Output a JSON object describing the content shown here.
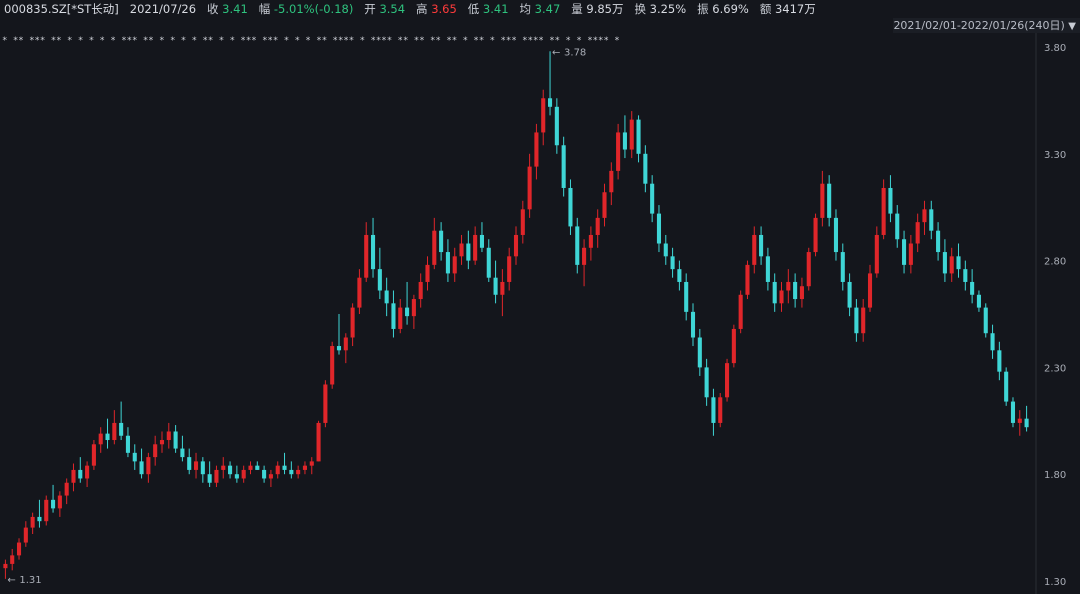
{
  "header": {
    "code": "000835.SZ[*ST长动]",
    "date": "2021/07/26",
    "close_label": "收",
    "close": "3.41",
    "change_label": "幅",
    "change": "-5.01%(-0.18)",
    "open_label": "开",
    "open": "3.54",
    "high_label": "高",
    "high": "3.65",
    "low_label": "低",
    "low": "3.41",
    "avg_label": "均",
    "avg": "3.47",
    "volume_label": "量",
    "volume": "9.85万",
    "turnover_label": "换",
    "turnover": "3.25%",
    "amplitude_label": "振",
    "amplitude": "6.69%",
    "amount_label": "额",
    "amount": "3417万"
  },
  "range": {
    "text": "2021/02/01-2022/01/26(240日)",
    "dropdown_icon": "triangle-down-icon"
  },
  "colors": {
    "up": "#e0262a",
    "down": "#3fd6d6",
    "flat": "#e8e8e8",
    "background": "#14161c",
    "grid": "#2a2d35",
    "max_label": "#ff3b3b",
    "min_label": "#2ec27e"
  },
  "chart_data": {
    "type": "candlestick",
    "title": "",
    "y_ticks": [
      "3.80",
      "3.30",
      "2.80",
      "2.30",
      "1.80",
      "1.30"
    ],
    "ylim": [
      1.3,
      3.8
    ],
    "max_marker": "3.78",
    "min_marker": "1.31",
    "star_row": "* ** *** ** *  *   *  *  *  *** ** *  * *  *  ** *  *   ***  ***  * * * ** ****  *  **** ** **  ** **  *  ** * *** **** **  *  * ****  *",
    "candles": [
      [
        1.36,
        1.4,
        1.31,
        1.38
      ],
      [
        1.38,
        1.45,
        1.35,
        1.42
      ],
      [
        1.42,
        1.5,
        1.4,
        1.48
      ],
      [
        1.48,
        1.58,
        1.46,
        1.55
      ],
      [
        1.55,
        1.62,
        1.52,
        1.6
      ],
      [
        1.6,
        1.68,
        1.55,
        1.58
      ],
      [
        1.58,
        1.7,
        1.56,
        1.68
      ],
      [
        1.68,
        1.75,
        1.62,
        1.64
      ],
      [
        1.64,
        1.72,
        1.6,
        1.7
      ],
      [
        1.7,
        1.78,
        1.66,
        1.76
      ],
      [
        1.76,
        1.85,
        1.72,
        1.82
      ],
      [
        1.82,
        1.88,
        1.76,
        1.78
      ],
      [
        1.78,
        1.86,
        1.74,
        1.84
      ],
      [
        1.84,
        1.96,
        1.82,
        1.94
      ],
      [
        1.94,
        2.02,
        1.9,
        1.99
      ],
      [
        1.99,
        2.06,
        1.92,
        1.96
      ],
      [
        1.96,
        2.1,
        1.94,
        2.04
      ],
      [
        2.04,
        2.14,
        1.96,
        1.98
      ],
      [
        1.98,
        2.02,
        1.88,
        1.9
      ],
      [
        1.9,
        1.94,
        1.82,
        1.86
      ],
      [
        1.86,
        1.92,
        1.78,
        1.8
      ],
      [
        1.8,
        1.9,
        1.76,
        1.88
      ],
      [
        1.88,
        1.98,
        1.84,
        1.94
      ],
      [
        1.94,
        2.0,
        1.9,
        1.96
      ],
      [
        1.96,
        2.04,
        1.92,
        2.0
      ],
      [
        2.0,
        2.03,
        1.9,
        1.92
      ],
      [
        1.92,
        1.98,
        1.86,
        1.88
      ],
      [
        1.88,
        1.92,
        1.8,
        1.82
      ],
      [
        1.82,
        1.9,
        1.78,
        1.86
      ],
      [
        1.86,
        1.88,
        1.76,
        1.8
      ],
      [
        1.8,
        1.86,
        1.74,
        1.76
      ],
      [
        1.76,
        1.84,
        1.74,
        1.82
      ],
      [
        1.82,
        1.88,
        1.78,
        1.84
      ],
      [
        1.84,
        1.86,
        1.78,
        1.8
      ],
      [
        1.8,
        1.84,
        1.76,
        1.78
      ],
      [
        1.78,
        1.84,
        1.76,
        1.82
      ],
      [
        1.82,
        1.86,
        1.8,
        1.84
      ],
      [
        1.84,
        1.86,
        1.82,
        1.82
      ],
      [
        1.82,
        1.84,
        1.76,
        1.78
      ],
      [
        1.78,
        1.82,
        1.74,
        1.8
      ],
      [
        1.8,
        1.86,
        1.78,
        1.84
      ],
      [
        1.84,
        1.9,
        1.8,
        1.82
      ],
      [
        1.82,
        1.86,
        1.78,
        1.8
      ],
      [
        1.8,
        1.84,
        1.78,
        1.82
      ],
      [
        1.82,
        1.86,
        1.8,
        1.84
      ],
      [
        1.84,
        1.88,
        1.8,
        1.86
      ],
      [
        1.86,
        2.05,
        1.86,
        2.04
      ],
      [
        2.04,
        2.24,
        2.02,
        2.22
      ],
      [
        2.22,
        2.42,
        2.2,
        2.4
      ],
      [
        2.4,
        2.55,
        2.36,
        2.38
      ],
      [
        2.38,
        2.46,
        2.32,
        2.44
      ],
      [
        2.44,
        2.6,
        2.4,
        2.58
      ],
      [
        2.58,
        2.76,
        2.55,
        2.72
      ],
      [
        2.72,
        2.98,
        2.7,
        2.92
      ],
      [
        2.92,
        3.0,
        2.72,
        2.76
      ],
      [
        2.76,
        2.86,
        2.62,
        2.66
      ],
      [
        2.66,
        2.72,
        2.54,
        2.6
      ],
      [
        2.6,
        2.66,
        2.44,
        2.48
      ],
      [
        2.48,
        2.62,
        2.46,
        2.58
      ],
      [
        2.58,
        2.7,
        2.5,
        2.54
      ],
      [
        2.54,
        2.64,
        2.48,
        2.62
      ],
      [
        2.62,
        2.74,
        2.58,
        2.7
      ],
      [
        2.7,
        2.82,
        2.66,
        2.78
      ],
      [
        2.78,
        3.0,
        2.76,
        2.94
      ],
      [
        2.94,
        2.98,
        2.8,
        2.84
      ],
      [
        2.84,
        2.9,
        2.7,
        2.74
      ],
      [
        2.74,
        2.86,
        2.7,
        2.82
      ],
      [
        2.82,
        2.92,
        2.78,
        2.88
      ],
      [
        2.88,
        2.94,
        2.76,
        2.8
      ],
      [
        2.8,
        2.96,
        2.78,
        2.92
      ],
      [
        2.92,
        2.98,
        2.84,
        2.86
      ],
      [
        2.86,
        2.9,
        2.7,
        2.72
      ],
      [
        2.72,
        2.8,
        2.6,
        2.64
      ],
      [
        2.64,
        2.76,
        2.54,
        2.7
      ],
      [
        2.7,
        2.86,
        2.66,
        2.82
      ],
      [
        2.82,
        2.96,
        2.78,
        2.92
      ],
      [
        2.92,
        3.08,
        2.88,
        3.04
      ],
      [
        3.04,
        3.3,
        3.0,
        3.24
      ],
      [
        3.24,
        3.44,
        3.18,
        3.4
      ],
      [
        3.4,
        3.6,
        3.34,
        3.56
      ],
      [
        3.56,
        3.78,
        3.48,
        3.52
      ],
      [
        3.52,
        3.56,
        3.3,
        3.34
      ],
      [
        3.34,
        3.38,
        3.1,
        3.14
      ],
      [
        3.14,
        3.18,
        2.92,
        2.96
      ],
      [
        2.96,
        3.0,
        2.74,
        2.78
      ],
      [
        2.78,
        2.9,
        2.68,
        2.86
      ],
      [
        2.86,
        2.96,
        2.8,
        2.92
      ],
      [
        2.92,
        3.04,
        2.86,
        3.0
      ],
      [
        3.0,
        3.16,
        2.96,
        3.12
      ],
      [
        3.12,
        3.26,
        3.06,
        3.22
      ],
      [
        3.22,
        3.44,
        3.18,
        3.4
      ],
      [
        3.4,
        3.48,
        3.28,
        3.32
      ],
      [
        3.32,
        3.5,
        3.28,
        3.46
      ],
      [
        3.46,
        3.48,
        3.26,
        3.3
      ],
      [
        3.3,
        3.34,
        3.12,
        3.16
      ],
      [
        3.16,
        3.2,
        2.98,
        3.02
      ],
      [
        3.02,
        3.06,
        2.84,
        2.88
      ],
      [
        2.88,
        2.92,
        2.78,
        2.82
      ],
      [
        2.82,
        2.86,
        2.72,
        2.76
      ],
      [
        2.76,
        2.8,
        2.66,
        2.7
      ],
      [
        2.7,
        2.74,
        2.52,
        2.56
      ],
      [
        2.56,
        2.6,
        2.4,
        2.44
      ],
      [
        2.44,
        2.48,
        2.26,
        2.3
      ],
      [
        2.3,
        2.34,
        2.12,
        2.16
      ],
      [
        2.16,
        2.2,
        1.98,
        2.04
      ],
      [
        2.04,
        2.18,
        2.02,
        2.16
      ],
      [
        2.16,
        2.34,
        2.14,
        2.32
      ],
      [
        2.32,
        2.5,
        2.3,
        2.48
      ],
      [
        2.48,
        2.66,
        2.46,
        2.64
      ],
      [
        2.64,
        2.8,
        2.62,
        2.78
      ],
      [
        2.78,
        2.96,
        2.74,
        2.92
      ],
      [
        2.92,
        2.96,
        2.78,
        2.82
      ],
      [
        2.82,
        2.86,
        2.66,
        2.7
      ],
      [
        2.7,
        2.74,
        2.56,
        2.6
      ],
      [
        2.6,
        2.7,
        2.56,
        2.66
      ],
      [
        2.66,
        2.76,
        2.6,
        2.7
      ],
      [
        2.7,
        2.74,
        2.58,
        2.62
      ],
      [
        2.62,
        2.72,
        2.58,
        2.68
      ],
      [
        2.68,
        2.86,
        2.66,
        2.84
      ],
      [
        2.84,
        3.02,
        2.82,
        3.0
      ],
      [
        3.0,
        3.22,
        2.96,
        3.16
      ],
      [
        3.16,
        3.2,
        2.96,
        3.0
      ],
      [
        3.0,
        3.04,
        2.8,
        2.84
      ],
      [
        2.84,
        2.88,
        2.66,
        2.7
      ],
      [
        2.7,
        2.74,
        2.54,
        2.58
      ],
      [
        2.58,
        2.62,
        2.42,
        2.46
      ],
      [
        2.46,
        2.62,
        2.42,
        2.58
      ],
      [
        2.58,
        2.78,
        2.56,
        2.74
      ],
      [
        2.74,
        2.96,
        2.72,
        2.92
      ],
      [
        2.92,
        3.18,
        2.9,
        3.14
      ],
      [
        3.14,
        3.2,
        2.98,
        3.02
      ],
      [
        3.02,
        3.06,
        2.86,
        2.9
      ],
      [
        2.9,
        2.94,
        2.74,
        2.78
      ],
      [
        2.78,
        2.92,
        2.74,
        2.88
      ],
      [
        2.88,
        3.02,
        2.84,
        2.98
      ],
      [
        2.98,
        3.08,
        2.92,
        3.04
      ],
      [
        3.04,
        3.08,
        2.9,
        2.94
      ],
      [
        2.94,
        2.98,
        2.8,
        2.84
      ],
      [
        2.84,
        2.9,
        2.7,
        2.74
      ],
      [
        2.74,
        2.86,
        2.7,
        2.82
      ],
      [
        2.82,
        2.88,
        2.72,
        2.76
      ],
      [
        2.76,
        2.8,
        2.66,
        2.7
      ],
      [
        2.7,
        2.76,
        2.6,
        2.64
      ],
      [
        2.64,
        2.66,
        2.56,
        2.58
      ],
      [
        2.58,
        2.6,
        2.44,
        2.46
      ],
      [
        2.46,
        2.5,
        2.34,
        2.38
      ],
      [
        2.38,
        2.42,
        2.24,
        2.28
      ],
      [
        2.28,
        2.3,
        2.12,
        2.14
      ],
      [
        2.14,
        2.16,
        2.02,
        2.04
      ],
      [
        2.04,
        2.1,
        1.98,
        2.06
      ],
      [
        2.06,
        2.12,
        2.0,
        2.02
      ]
    ]
  }
}
